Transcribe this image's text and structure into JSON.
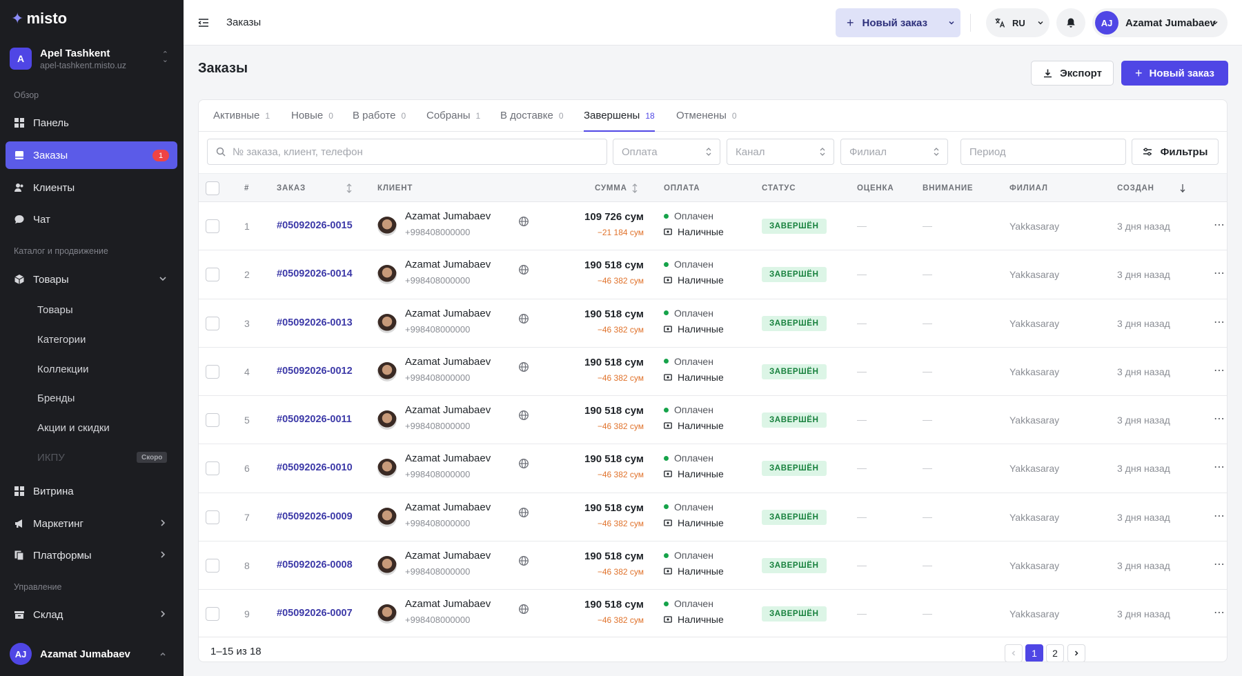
{
  "brand": {
    "logo": "misto"
  },
  "store": {
    "avatar": "A",
    "name": "Apel Tashkent",
    "domain": "apel-tashkent.misto.uz"
  },
  "sidebar": {
    "sections": {
      "overview": "Обзор",
      "catalog": "Каталог и продвижение",
      "management": "Управление"
    },
    "items": {
      "dashboard": "Панель",
      "orders": "Заказы",
      "orders_badge": "1",
      "clients": "Клиенты",
      "chat": "Чат",
      "products": "Товары",
      "showcase": "Витрина",
      "marketing": "Маркетинг",
      "platforms": "Платформы",
      "warehouse": "Склад"
    },
    "product_sub": [
      "Товары",
      "Категории",
      "Коллекции",
      "Бренды",
      "Акции и скидки",
      "ИКПУ"
    ],
    "soon_badge": "Скоро",
    "user": {
      "initials": "AJ",
      "name": "Azamat Jumabaev"
    }
  },
  "topbar": {
    "breadcrumb": "Заказы",
    "new_order": "Новый заказ",
    "lang": "RU",
    "user_initials": "AJ",
    "user_name": "Azamat Jumabaev"
  },
  "page": {
    "title": "Заказы",
    "export": "Экспорт",
    "new_order": "Новый заказ"
  },
  "tabs": [
    {
      "label": "Активные",
      "count": "1"
    },
    {
      "label": "Новые",
      "count": "0"
    },
    {
      "label": "В работе",
      "count": "0"
    },
    {
      "label": "Собраны",
      "count": "1"
    },
    {
      "label": "В доставке",
      "count": "0"
    },
    {
      "label": "Завершены",
      "count": "18"
    },
    {
      "label": "Отменены",
      "count": "0"
    }
  ],
  "filters": {
    "search_placeholder": "№ заказа, клиент, телефон",
    "payment": "Оплата",
    "channel": "Канал",
    "branch": "Филиал",
    "period": "Период",
    "filters_button": "Фильтры"
  },
  "table": {
    "headers": {
      "num": "#",
      "order": "ЗАКАЗ",
      "client": "КЛИЕНТ",
      "sum": "СУММА",
      "payment": "ОПЛАТА",
      "status": "СТАТУС",
      "rating": "ОЦЕНКА",
      "attention": "ВНИМАНИЕ",
      "branch": "ФИЛИАЛ",
      "created": "СОЗДАН"
    },
    "rows": [
      {
        "num": "1",
        "order": "#05092026-0015",
        "client": "Azamat Jumabaev",
        "phone": "+998408000000",
        "sum": "109 726 сум",
        "discount": "−21 184 сум",
        "paid": "Оплачен",
        "method": "Наличные",
        "status": "ЗАВЕРШЁН",
        "rating": "—",
        "attention": "—",
        "branch": "Yakkasaray",
        "created": "3 дня назад"
      },
      {
        "num": "2",
        "order": "#05092026-0014",
        "client": "Azamat Jumabaev",
        "phone": "+998408000000",
        "sum": "190 518 сум",
        "discount": "−46 382 сум",
        "paid": "Оплачен",
        "method": "Наличные",
        "status": "ЗАВЕРШЁН",
        "rating": "—",
        "attention": "—",
        "branch": "Yakkasaray",
        "created": "3 дня назад"
      },
      {
        "num": "3",
        "order": "#05092026-0013",
        "client": "Azamat Jumabaev",
        "phone": "+998408000000",
        "sum": "190 518 сум",
        "discount": "−46 382 сум",
        "paid": "Оплачен",
        "method": "Наличные",
        "status": "ЗАВЕРШЁН",
        "rating": "—",
        "attention": "—",
        "branch": "Yakkasaray",
        "created": "3 дня назад"
      },
      {
        "num": "4",
        "order": "#05092026-0012",
        "client": "Azamat Jumabaev",
        "phone": "+998408000000",
        "sum": "190 518 сум",
        "discount": "−46 382 сум",
        "paid": "Оплачен",
        "method": "Наличные",
        "status": "ЗАВЕРШЁН",
        "rating": "—",
        "attention": "—",
        "branch": "Yakkasaray",
        "created": "3 дня назад"
      },
      {
        "num": "5",
        "order": "#05092026-0011",
        "client": "Azamat Jumabaev",
        "phone": "+998408000000",
        "sum": "190 518 сум",
        "discount": "−46 382 сум",
        "paid": "Оплачен",
        "method": "Наличные",
        "status": "ЗАВЕРШЁН",
        "rating": "—",
        "attention": "—",
        "branch": "Yakkasaray",
        "created": "3 дня назад"
      },
      {
        "num": "6",
        "order": "#05092026-0010",
        "client": "Azamat Jumabaev",
        "phone": "+998408000000",
        "sum": "190 518 сум",
        "discount": "−46 382 сум",
        "paid": "Оплачен",
        "method": "Наличные",
        "status": "ЗАВЕРШЁН",
        "rating": "—",
        "attention": "—",
        "branch": "Yakkasaray",
        "created": "3 дня назад"
      },
      {
        "num": "7",
        "order": "#05092026-0009",
        "client": "Azamat Jumabaev",
        "phone": "+998408000000",
        "sum": "190 518 сум",
        "discount": "−46 382 сум",
        "paid": "Оплачен",
        "method": "Наличные",
        "status": "ЗАВЕРШЁН",
        "rating": "—",
        "attention": "—",
        "branch": "Yakkasaray",
        "created": "3 дня назад"
      },
      {
        "num": "8",
        "order": "#05092026-0008",
        "client": "Azamat Jumabaev",
        "phone": "+998408000000",
        "sum": "190 518 сум",
        "discount": "−46 382 сум",
        "paid": "Оплачен",
        "method": "Наличные",
        "status": "ЗАВЕРШЁН",
        "rating": "—",
        "attention": "—",
        "branch": "Yakkasaray",
        "created": "3 дня назад"
      },
      {
        "num": "9",
        "order": "#05092026-0007",
        "client": "Azamat Jumabaev",
        "phone": "+998408000000",
        "sum": "190 518 сум",
        "discount": "−46 382 сум",
        "paid": "Оплачен",
        "method": "Наличные",
        "status": "ЗАВЕРШЁН",
        "rating": "—",
        "attention": "—",
        "branch": "Yakkasaray",
        "created": "3 дня назад"
      }
    ]
  },
  "pagination": {
    "range": "1–15 из 18",
    "pages": [
      "1",
      "2"
    ],
    "current": "1"
  },
  "colors": {
    "accent": "#4f46e5",
    "sidebar_bg": "#1c1d21",
    "badge": "#ef4444",
    "status_bg": "#dcf5e6",
    "status_text": "#16803c",
    "discount": "#e0722b"
  }
}
